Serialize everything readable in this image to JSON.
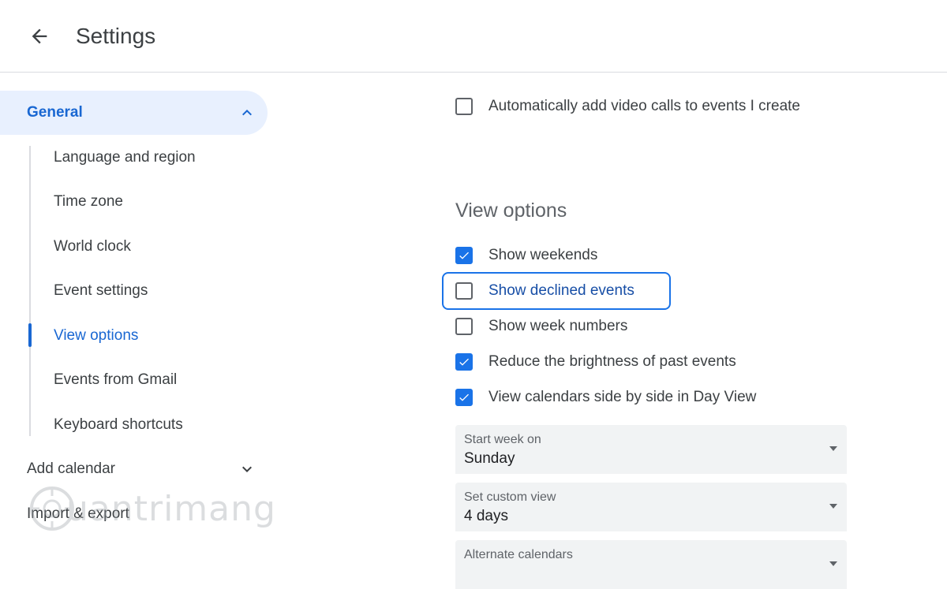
{
  "header": {
    "title": "Settings"
  },
  "sidebar": {
    "general_label": "General",
    "items": [
      "Language and region",
      "Time zone",
      "World clock",
      "Event settings",
      "View options",
      "Events from Gmail",
      "Keyboard shortcuts"
    ],
    "active_item": "View options",
    "add_calendar": "Add calendar",
    "import_export": "Import & export"
  },
  "main": {
    "auto_video": {
      "label": "Automatically add video calls to events I create",
      "checked": false
    },
    "view_options_title": "View options",
    "options": [
      {
        "label": "Show weekends",
        "checked": true
      },
      {
        "label": "Show declined events",
        "checked": false,
        "focused": true
      },
      {
        "label": "Show week numbers",
        "checked": false
      },
      {
        "label": "Reduce the brightness of past events",
        "checked": true
      },
      {
        "label": "View calendars side by side in Day View",
        "checked": true
      }
    ],
    "selects": [
      {
        "label": "Start week on",
        "value": "Sunday"
      },
      {
        "label": "Set custom view",
        "value": "4 days"
      },
      {
        "label": "Alternate calendars",
        "value": ""
      }
    ]
  },
  "watermark": "uantrimang",
  "colors": {
    "accent": "#1a73e8",
    "active_text": "#1967d2",
    "active_bg": "#e8f0fe"
  }
}
